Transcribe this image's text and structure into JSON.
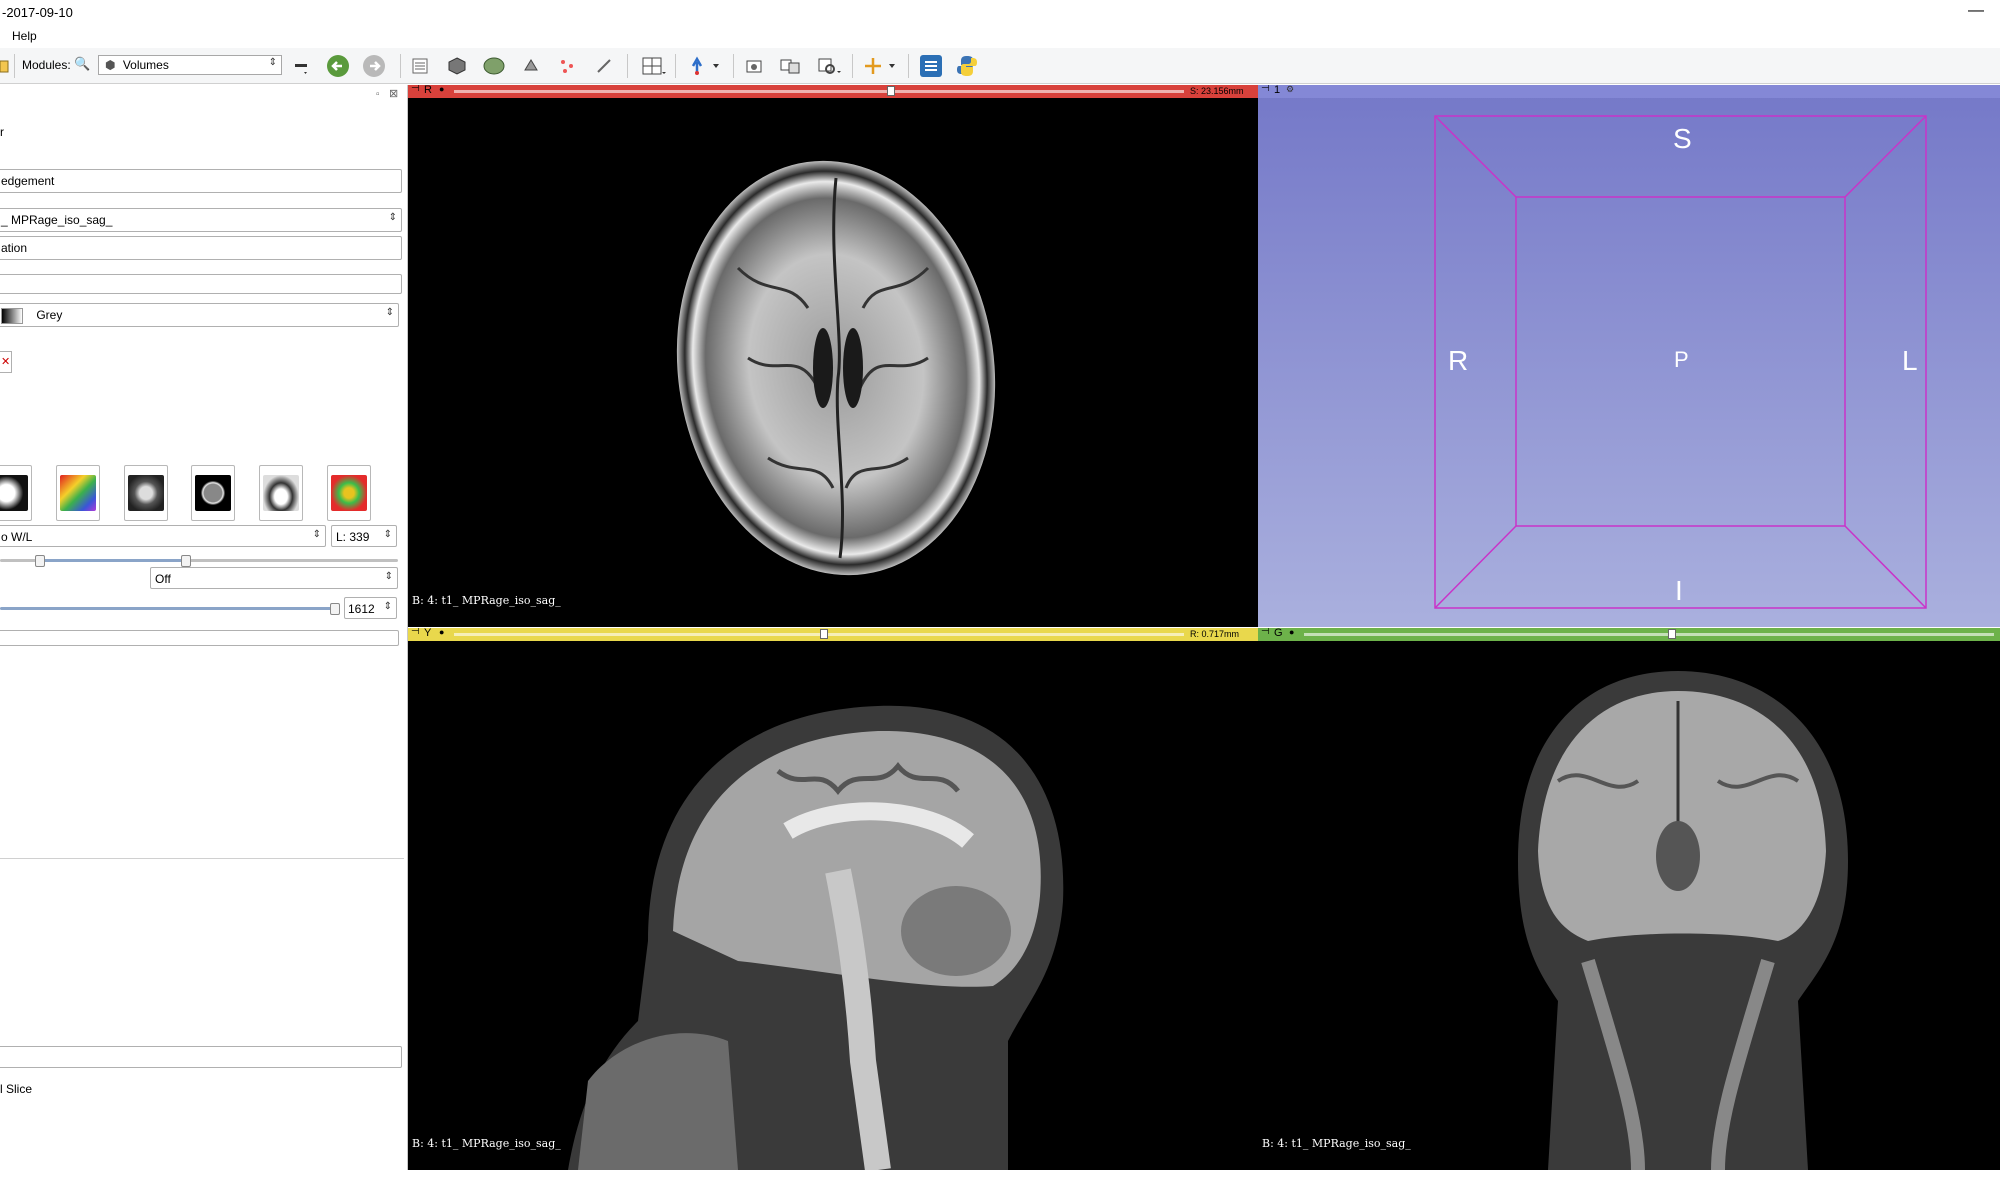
{
  "window": {
    "title": "-2017-09-10",
    "minimize": "—"
  },
  "menu": {
    "items": [
      "Help"
    ]
  },
  "toolbar": {
    "modules_label": "Modules:",
    "module_selected": "Volumes"
  },
  "panel": {
    "partial_label_top": "r",
    "acknowledgement_label": "edgement",
    "volume_select": "_ MPRage_iso_sag_",
    "section_information": "ation",
    "lookup_table": "Grey",
    "window_level_preset": "o W/L",
    "level_value": "L: 339",
    "interpolate_mode": "Off",
    "threshold_value": "1612",
    "bottom_label": "l Slice"
  },
  "views": {
    "red": {
      "tag": "R",
      "readout": "S: 23.156mm",
      "volume_label": "B: 4: t1_ MPRage_iso_sag_",
      "color": "#d8413b",
      "slider_pos": 0.51
    },
    "yellow": {
      "tag": "Y",
      "readout": "R: 0.717mm",
      "volume_label": "B: 4: t1_ MPRage_iso_sag_",
      "color": "#e9d84c",
      "slider_pos": 0.5
    },
    "green": {
      "tag": "G",
      "readout": "",
      "volume_label": "B: 4: t1_ MPRage_iso_sag_",
      "color": "#6db24a",
      "slider_pos": 0.5
    },
    "three_d": {
      "tag": "1",
      "color": "#8488d6",
      "labels": {
        "superior": "S",
        "inferior": "I",
        "right": "R",
        "left": "L",
        "posterior": "P"
      }
    }
  }
}
